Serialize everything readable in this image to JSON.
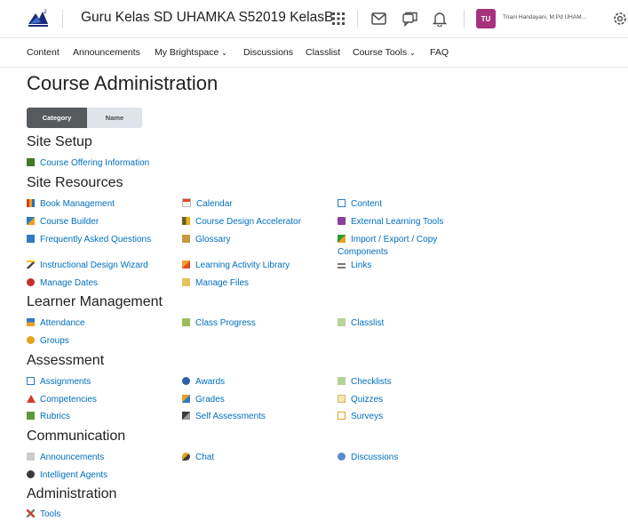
{
  "header": {
    "course_title": "Guru Kelas SD UHAMKA S52019 KelasB",
    "avatar_initials": "TU",
    "user_name": "Triani Handayani, M.Pd UHAM...",
    "avatar_color": "#a6327e"
  },
  "nav": {
    "content": "Content",
    "announcements": "Announcements",
    "my_brightspace": "My Brightspace",
    "discussions": "Discussions",
    "classlist": "Classlist",
    "course_tools": "Course Tools",
    "faq": "FAQ"
  },
  "page": {
    "title": "Course Administration",
    "view_toggle": {
      "category": "Category",
      "name": "Name",
      "selected": "Category"
    }
  },
  "sections": {
    "site_setup": {
      "title": "Site Setup",
      "items": {
        "course_offering_information": "Course Offering Information"
      }
    },
    "site_resources": {
      "title": "Site Resources",
      "items": {
        "book_management": "Book Management",
        "calendar": "Calendar",
        "content": "Content",
        "course_builder": "Course Builder",
        "course_design_accelerator": "Course Design Accelerator",
        "external_learning_tools": "External Learning Tools",
        "faq": "Frequently Asked Questions",
        "glossary": "Glossary",
        "import_line1": "Import / Export / Copy",
        "import_line2": "Components",
        "instructional_design_wizard": "Instructional Design Wizard",
        "learning_activity_library": "Learning Activity Library",
        "links": "Links",
        "manage_dates": "Manage Dates",
        "manage_files": "Manage Files"
      }
    },
    "learner_management": {
      "title": "Learner Management",
      "items": {
        "attendance": "Attendance",
        "class_progress": "Class Progress",
        "classlist": "Classlist",
        "groups": "Groups"
      }
    },
    "assessment": {
      "title": "Assessment",
      "items": {
        "assignments": "Assignments",
        "awards": "Awards",
        "checklists": "Checklists",
        "competencies": "Competencies",
        "grades": "Grades",
        "quizzes": "Quizzes",
        "rubrics": "Rubrics",
        "self_assessments": "Self Assessments",
        "surveys": "Surveys"
      }
    },
    "communication": {
      "title": "Communication",
      "items": {
        "announcements": "Announcements",
        "chat": "Chat",
        "discussions": "Discussions",
        "intelligent_agents": "Intelligent Agents"
      }
    },
    "administration": {
      "title": "Administration",
      "items": {
        "tools": "Tools"
      }
    }
  },
  "colors": {
    "link": "#006fbf",
    "toggle_selected": "#565a5c"
  }
}
